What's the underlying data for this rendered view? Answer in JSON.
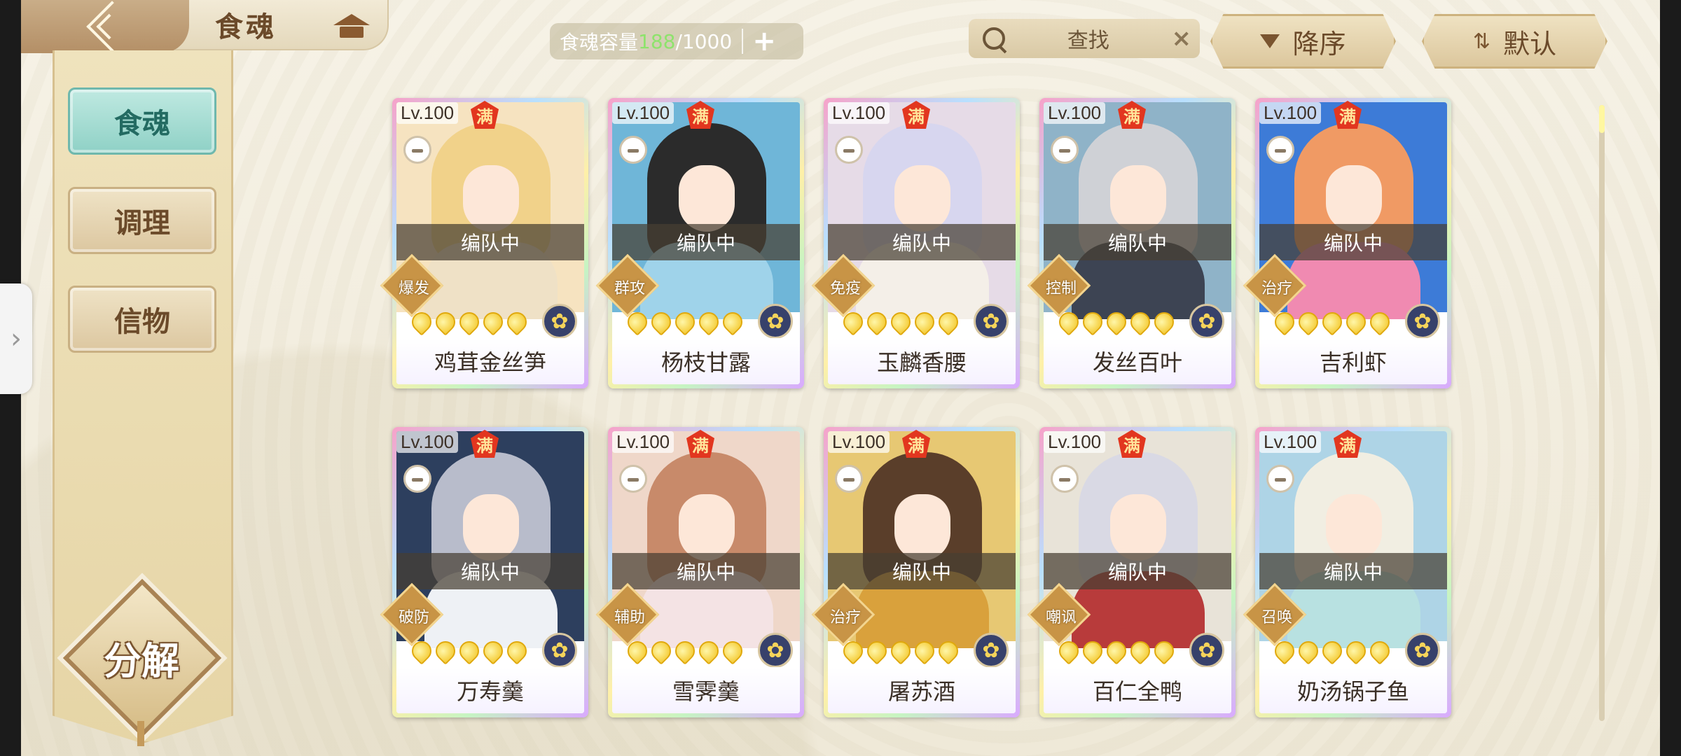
{
  "header": {
    "title": "食魂",
    "capacity_label": "食魂容量",
    "capacity_current": "188",
    "capacity_max": "/1000",
    "capacity_add": "+",
    "search_label": "查找",
    "search_clear": "×",
    "sort_label": "降序",
    "default_label": "默认"
  },
  "sidebar": {
    "tabs": [
      {
        "label": "食魂",
        "active": true
      },
      {
        "label": "调理",
        "active": false
      },
      {
        "label": "信物",
        "active": false
      }
    ],
    "decompose_label": "分解"
  },
  "cards": [
    {
      "level": "Lv.100",
      "full": "满",
      "status": "编队中",
      "role": "爆发",
      "stars": 5,
      "name": "鸡茸金丝笋",
      "hair": "#f1d28a",
      "outfit": "#efe1c6",
      "bg": "#f6e3c0"
    },
    {
      "level": "Lv.100",
      "full": "满",
      "status": "编队中",
      "role": "群攻",
      "stars": 5,
      "name": "杨枝甘露",
      "hair": "#2b2b2b",
      "outfit": "#9fd3ea",
      "bg": "#6fb6d8"
    },
    {
      "level": "Lv.100",
      "full": "满",
      "status": "编队中",
      "role": "免疫",
      "stars": 5,
      "name": "玉麟香腰",
      "hair": "#d7d6ef",
      "outfit": "#f4efe8",
      "bg": "#e6dbe7"
    },
    {
      "level": "Lv.100",
      "full": "满",
      "status": "编队中",
      "role": "控制",
      "stars": 5,
      "name": "发丝百叶",
      "hair": "#cfd1d6",
      "outfit": "#3d4453",
      "bg": "#8fb3c8"
    },
    {
      "level": "Lv.100",
      "full": "满",
      "status": "编队中",
      "role": "治疗",
      "stars": 5,
      "name": "吉利虾",
      "hair": "#f09a64",
      "outfit": "#f08ab1",
      "bg": "#3d7bd7"
    },
    {
      "level": "Lv.100",
      "full": "满",
      "status": "编队中",
      "role": "破防",
      "stars": 5,
      "name": "万寿羹",
      "hair": "#b8bccb",
      "outfit": "#eef1f5",
      "bg": "#2d3f5e"
    },
    {
      "level": "Lv.100",
      "full": "满",
      "status": "编队中",
      "role": "辅助",
      "stars": 5,
      "name": "雪霁羹",
      "hair": "#c88a6a",
      "outfit": "#f4e3e4",
      "bg": "#efd7c9"
    },
    {
      "level": "Lv.100",
      "full": "满",
      "status": "编队中",
      "role": "治疗",
      "stars": 5,
      "name": "屠苏酒",
      "hair": "#5a3e2a",
      "outfit": "#d9a13c",
      "bg": "#e7c873"
    },
    {
      "level": "Lv.100",
      "full": "满",
      "status": "编队中",
      "role": "嘲讽",
      "stars": 5,
      "name": "百仁全鸭",
      "hair": "#d9d9e4",
      "outfit": "#b83b3b",
      "bg": "#e8e3d8"
    },
    {
      "level": "Lv.100",
      "full": "满",
      "status": "编队中",
      "role": "召唤",
      "stars": 5,
      "name": "奶汤锅子鱼",
      "hair": "#f1eee2",
      "outfit": "#b8e1e1",
      "bg": "#aed4e6"
    }
  ],
  "colors": {
    "accent_active": "#8fd1c6",
    "capacity_current": "#8ee36c",
    "full_badge": "#e2361f"
  }
}
